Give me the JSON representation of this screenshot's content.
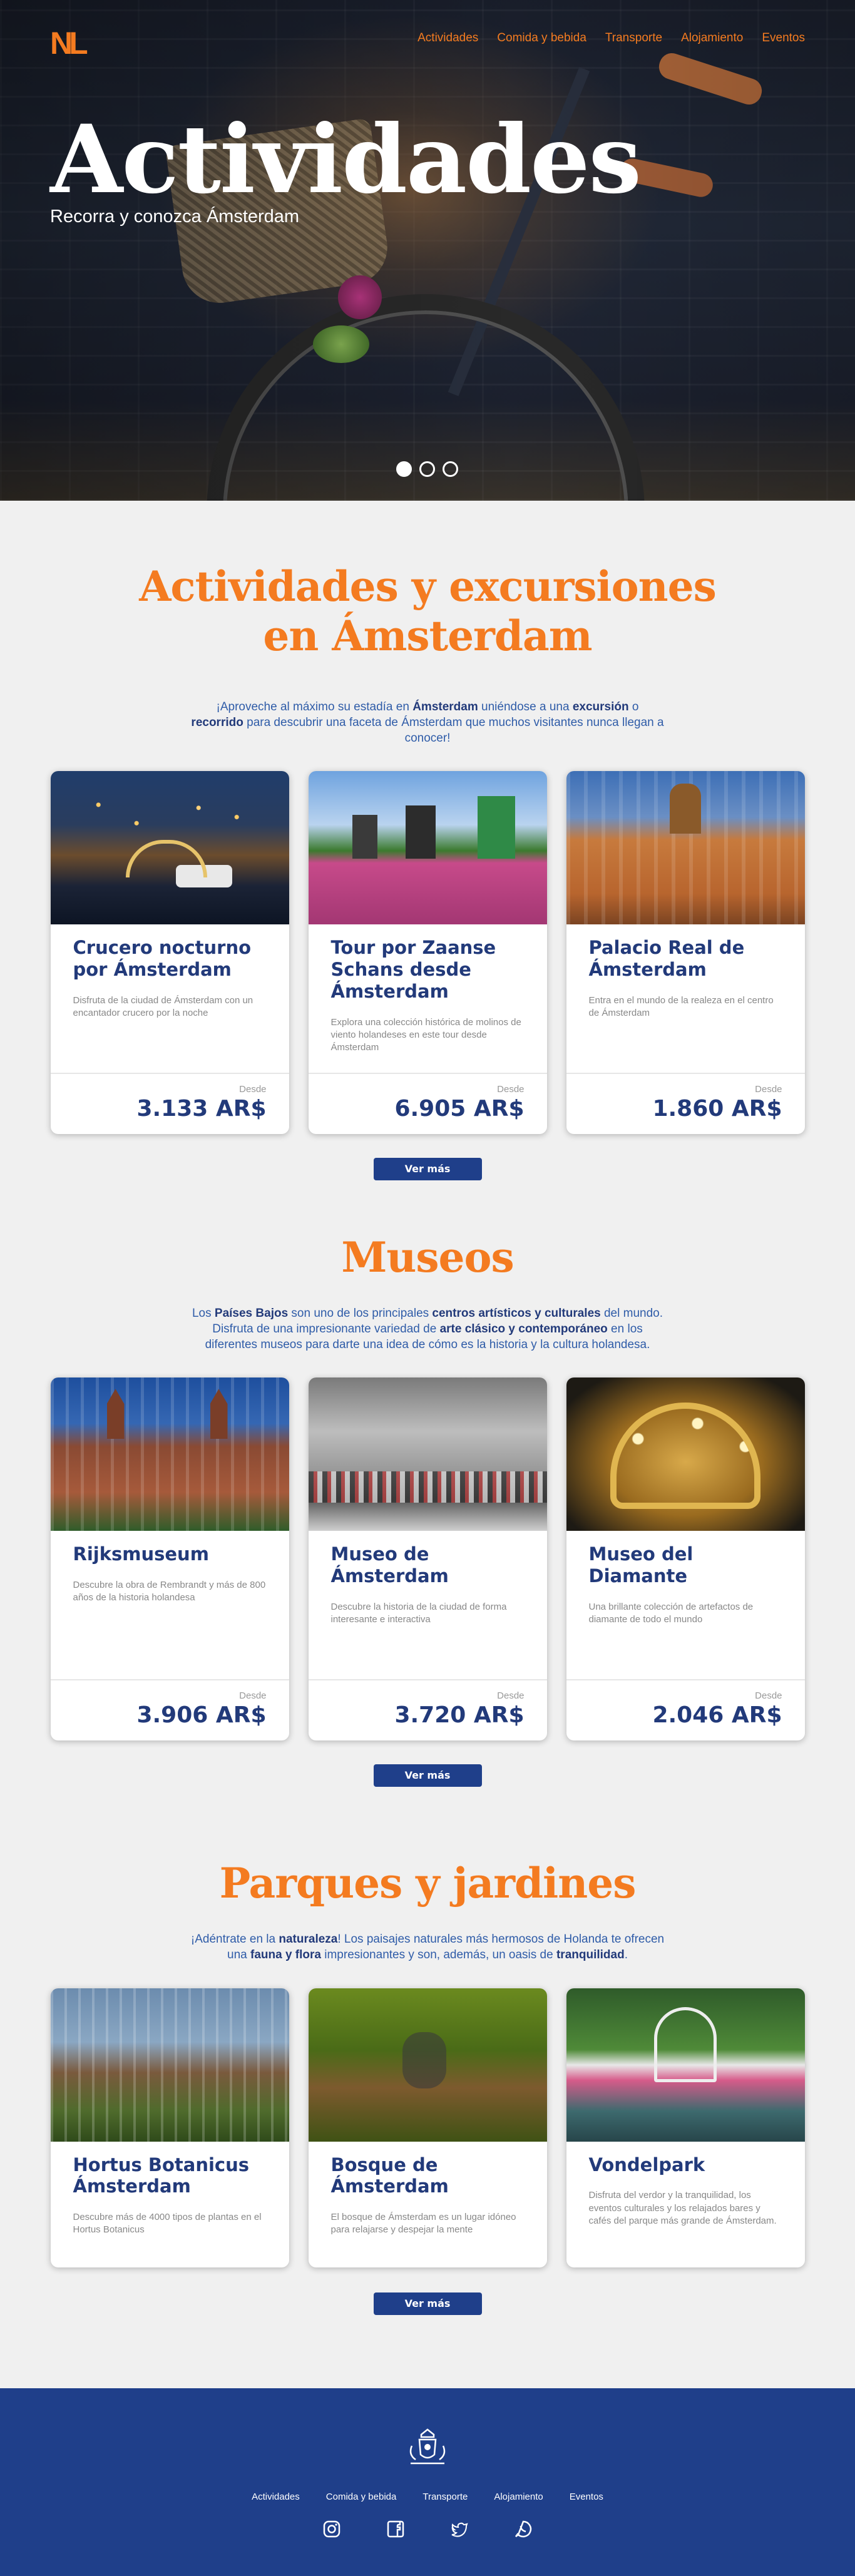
{
  "brand": {
    "logo": "NL"
  },
  "nav": {
    "items": [
      "Actividades",
      "Comida y bebida",
      "Transporte",
      "Alojamiento",
      "Eventos"
    ]
  },
  "hero": {
    "title": "Actividades",
    "subtitle": "Recorra y conozca Ámsterdam",
    "slides": 3,
    "active_slide": 1
  },
  "sections": [
    {
      "title_line1": "Actividades y excursiones",
      "title_line2": "en Ámsterdam",
      "intro": "¡Aproveche al máximo su estadía en Ámsterdam uniéndose a una excursión o recorrido para descubrir una faceta de Ámsterdam que muchos visitantes nunca llegan a conocer!",
      "cards": [
        {
          "title": "Crucero nocturno por Ámsterdam",
          "desc": "Disfruta de la ciudad de Ámsterdam con un encantador crucero por la noche",
          "desde": "Desde",
          "price": "3.133 AR$"
        },
        {
          "title": "Tour por Zaanse Schans desde Ámsterdam",
          "desc": "Explora una colección histórica de molinos de viento holandeses en este tour desde Ámsterdam",
          "desde": "Desde",
          "price": "6.905 AR$"
        },
        {
          "title": "Palacio Real de Ámsterdam",
          "desc": "Entra en el mundo de la realeza en el centro de Ámsterdam",
          "desde": "Desde",
          "price": "1.860 AR$"
        }
      ],
      "button": "Ver más"
    },
    {
      "title_line1": "Museos",
      "intro": "Los Países Bajos son uno de los principales centros artísticos y culturales del mundo. Disfruta de una impresionante variedad de arte clásico y contemporáneo en los diferentes museos para darte una idea de cómo es la historia y la cultura holandesa.",
      "cards": [
        {
          "title": "Rijksmuseum",
          "desc": "Descubre la obra de Rembrandt y más de 800 años de la historia holandesa",
          "desde": "Desde",
          "price": "3.906 AR$"
        },
        {
          "title": "Museo de Ámsterdam",
          "desc": "Descubre la historia de la ciudad de forma interesante e interactiva",
          "desde": "Desde",
          "price": "3.720 AR$"
        },
        {
          "title": "Museo del Diamante",
          "desc": "Una brillante colección de artefactos de diamante de todo el mundo",
          "desde": "Desde",
          "price": "2.046 AR$"
        }
      ],
      "button": "Ver más"
    },
    {
      "title_line1": "Parques y jardines",
      "intro": "¡Adéntrate en la naturaleza! Los paisajes naturales más hermosos de Holanda te ofrecen una fauna y flora impresionantes y son, además, un oasis de tranquilidad.",
      "cards": [
        {
          "title": "Hortus Botanicus Ámsterdam",
          "desc": "Descubre más de 4000 tipos de plantas en el Hortus Botanicus"
        },
        {
          "title": "Bosque de Ámsterdam",
          "desc": "El bosque de Ámsterdam es un lugar idóneo para relajarse y despejar la mente"
        },
        {
          "title": "Vondelpark",
          "desc": "Disfruta del verdor y la tranquilidad, los eventos culturales y los relajados bares y cafés del parque más grande de Ámsterdam."
        }
      ],
      "button": "Ver más"
    }
  ],
  "footer": {
    "links": [
      "Actividades",
      "Comida y bebida",
      "Transporte",
      "Alojamiento",
      "Eventos"
    ],
    "social": [
      "instagram-icon",
      "facebook-icon",
      "twitter-icon",
      "whatsapp-icon"
    ]
  },
  "colors": {
    "accent": "#f47b20",
    "navy": "#223a7a",
    "footer": "#1f3f8a",
    "page_bg": "#f0f0f0"
  }
}
